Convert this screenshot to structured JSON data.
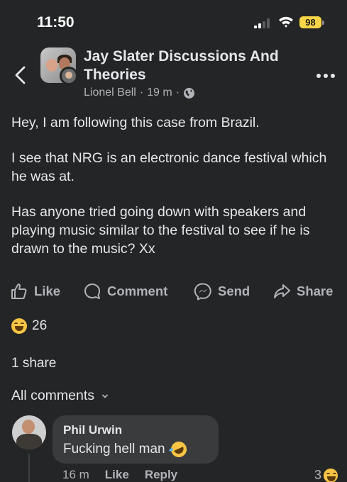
{
  "status_bar": {
    "time": "11:50",
    "battery": "98"
  },
  "header": {
    "group_name": "Jay Slater Discussions And Theories",
    "author": "Lionel Bell",
    "separator": "·",
    "time_ago": "19 m",
    "separator2": "·"
  },
  "post": {
    "paragraphs": [
      "Hey, I am following this case from Brazil.",
      "I see that NRG is an electronic dance festival which he was at.",
      "Has anyone tried going down with speakers and playing music similar to the festival to see if he is drawn to the music? Xx"
    ]
  },
  "actions": {
    "like": "Like",
    "comment": "Comment",
    "send": "Send",
    "share": "Share"
  },
  "reactions": {
    "count": "26"
  },
  "shares": "1 share",
  "comments_filter": "All comments",
  "comment": {
    "author": "Phil Urwin",
    "text": "Fucking hell man",
    "time": "16 m",
    "like": "Like",
    "reply": "Reply",
    "reaction_count": "3"
  },
  "colors": {
    "background": "#242526",
    "bubble": "#3a3b3c",
    "secondary_text": "#b0b3b8",
    "battery": "#f7d547"
  }
}
